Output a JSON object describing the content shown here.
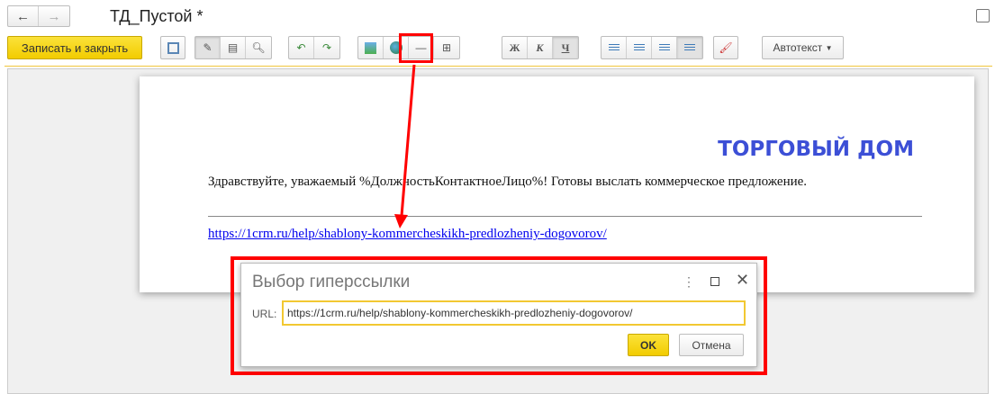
{
  "window": {
    "title": "ТД_Пустой *"
  },
  "toolbar": {
    "save_close": "Записать и закрыть",
    "bold": "Ж",
    "italic": "К",
    "underline": "Ч",
    "autotext": "Автотекст"
  },
  "document": {
    "heading": "ТОРГОВЫЙ ДОМ",
    "greeting": "Здравствуйте, уважаемый %ДолжностьКонтактноеЛицо%! Готовы выслать коммерческое предложение.",
    "link": "https://1crm.ru/help/shablony-kommercheskikh-predlozheniy-dogovorov/"
  },
  "dialog": {
    "title": "Выбор гиперссылки",
    "url_label": "URL:",
    "url_value": "https://1crm.ru/help/shablony-kommercheskikh-predlozheniy-dogovorov/",
    "ok": "OK",
    "cancel": "Отмена"
  },
  "colors": {
    "accent": "#f5d10c",
    "highlight": "#ff0000",
    "heading": "#3c4fd6"
  }
}
